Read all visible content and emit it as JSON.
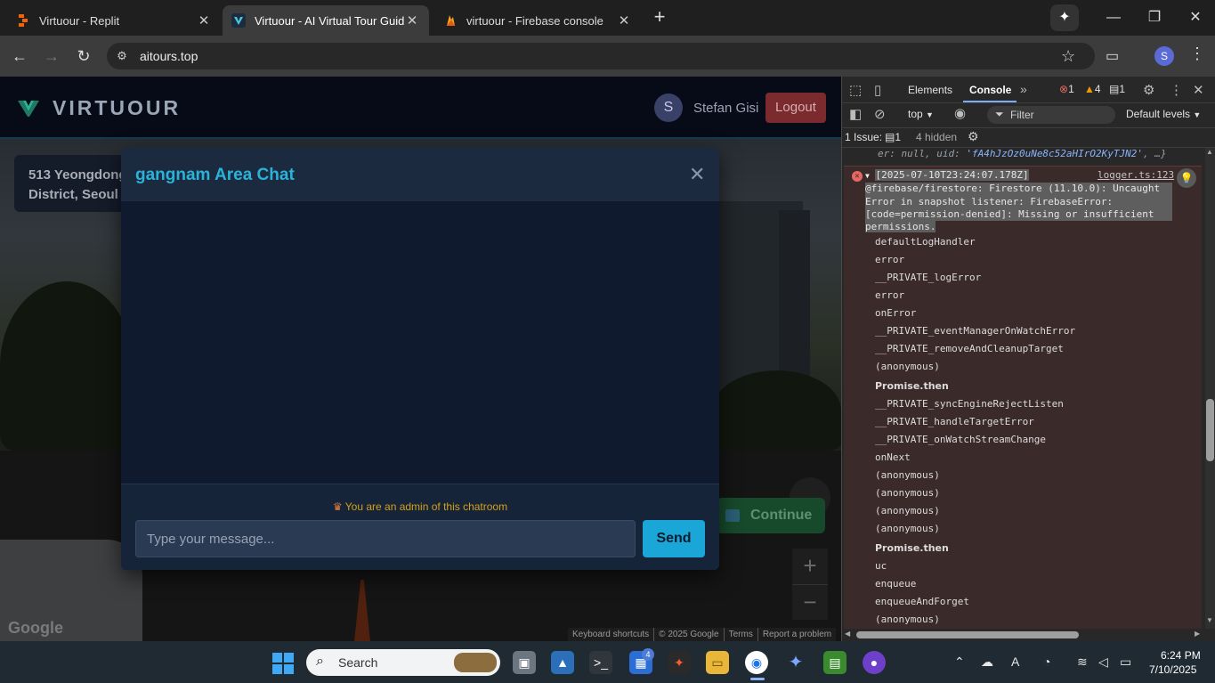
{
  "browser": {
    "tabs": [
      {
        "title": "Virtuour - Replit"
      },
      {
        "title": "Virtuour - AI Virtual Tour Guide"
      },
      {
        "title": "virtuour - Firebase console"
      }
    ],
    "url": "aitours.top",
    "profile_initial": "S"
  },
  "site": {
    "logo_text": "VIRTUOUR",
    "user_initial": "S",
    "user_name": "Stefan Gisi",
    "logout_label": "Logout",
    "address_line1": "513 Yeongdong",
    "address_line2": "District, Seoul",
    "continue_label": "Continue",
    "zoom_in": "+",
    "zoom_out": "−",
    "google_logo": "Google",
    "map_footer": [
      "Keyboard shortcuts",
      "© 2025 Google",
      "Terms",
      "Report a problem"
    ]
  },
  "chat": {
    "title": "gangnam Area Chat",
    "admin_note": "You are an admin of this chatroom",
    "input_placeholder": "Type your message...",
    "send_label": "Send"
  },
  "devtools": {
    "tabs": [
      "Elements",
      "Console"
    ],
    "error_count": "1",
    "warning_count": "4",
    "info_count": "1",
    "context": "top",
    "filter_placeholder": "Filter",
    "levels": "Default levels",
    "issues_label": "1 Issue:",
    "issues_count": "1",
    "hidden": "4 hidden",
    "prev_log_prefix": "er: null, uid: ",
    "prev_log_uid": "'fA4hJzOz0uNe8c52aHIrO2KyTJN2'",
    "prev_log_suffix": ", …}",
    "error_timestamp": "[2025-07-10T23:24:07.178Z]",
    "error_source": "logger.ts:123",
    "error_lines": [
      "@firebase/firestore: Firestore (11.10.0): Uncaught",
      "Error in snapshot listener: FirebaseError:",
      "[code=permission-denied]: Missing or insufficient",
      "permissions."
    ],
    "stack": [
      "defaultLogHandler",
      "error",
      "__PRIVATE_logError",
      "error",
      "onError",
      "__PRIVATE_eventManagerOnWatchError",
      "__PRIVATE_removeAndCleanupTarget",
      "(anonymous)",
      "Promise.then",
      "__PRIVATE_syncEngineRejectListen",
      "__PRIVATE_handleTargetError",
      "__PRIVATE_onWatchStreamChange",
      "onNext",
      "(anonymous)",
      "(anonymous)",
      "(anonymous)",
      "(anonymous)",
      "Promise.then",
      "uc",
      "enqueue",
      "enqueueAndForget",
      "(anonymous)"
    ]
  },
  "taskbar": {
    "search_label": "Search",
    "badge_count": "4",
    "time": "6:24 PM",
    "date": "7/10/2025"
  }
}
